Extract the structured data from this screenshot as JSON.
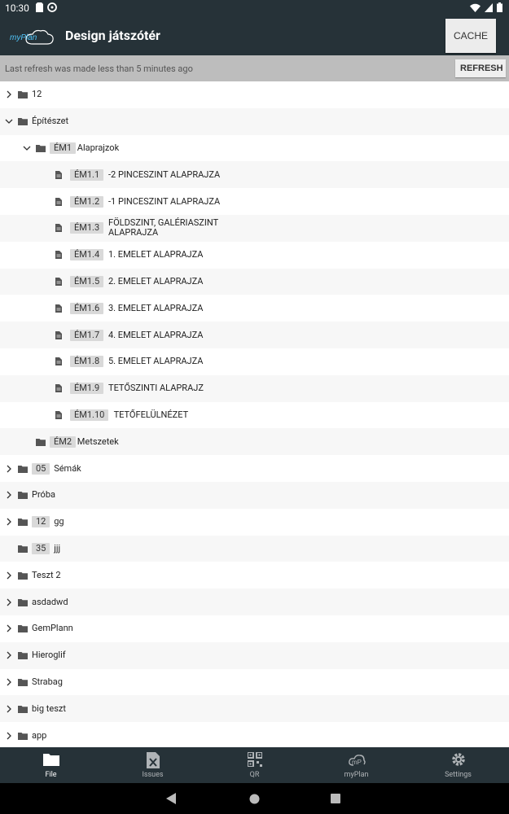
{
  "status": {
    "time": "10:30"
  },
  "header": {
    "logo_text": "myPlan",
    "title": "Design játszótér",
    "cache_label": "CACHE"
  },
  "refresh": {
    "message": "Last refresh was made less than 5 minutes ago",
    "button_label": "REFRESH"
  },
  "tree": [
    {
      "label": "12",
      "badge": "",
      "level": 0,
      "kind": "folder",
      "chevron": "right"
    },
    {
      "label": "Építészet",
      "badge": "",
      "level": 0,
      "kind": "folder",
      "chevron": "down"
    },
    {
      "label": "Alaprajzok",
      "badge": "ÉM1",
      "level": 1,
      "kind": "folder",
      "chevron": "down"
    },
    {
      "label": "-2 PINCESZINT ALAPRAJZA",
      "badge": "ÉM1.1",
      "level": 2,
      "kind": "doc",
      "chevron": ""
    },
    {
      "label": "-1 PINCESZINT ALAPRAJZA",
      "badge": "ÉM1.2",
      "level": 2,
      "kind": "doc",
      "chevron": ""
    },
    {
      "label": "FÖLDSZINT, GALÉRIASZINT\nALAPRAJZA",
      "badge": "ÉM1.3",
      "level": 2,
      "kind": "doc",
      "chevron": ""
    },
    {
      "label": "1. EMELET ALAPRAJZA",
      "badge": "ÉM1.4",
      "level": 2,
      "kind": "doc",
      "chevron": ""
    },
    {
      "label": "2. EMELET ALAPRAJZA",
      "badge": "ÉM1.5",
      "level": 2,
      "kind": "doc",
      "chevron": ""
    },
    {
      "label": "3. EMELET ALAPRAJZA",
      "badge": "ÉM1.6",
      "level": 2,
      "kind": "doc",
      "chevron": ""
    },
    {
      "label": "4. EMELET ALAPRAJZA",
      "badge": "ÉM1.7",
      "level": 2,
      "kind": "doc",
      "chevron": ""
    },
    {
      "label": "5. EMELET ALAPRAJZA",
      "badge": "ÉM1.8",
      "level": 2,
      "kind": "doc",
      "chevron": ""
    },
    {
      "label": "TETŐSZINTI ALAPRAJZ",
      "badge": "ÉM1.9",
      "level": 2,
      "kind": "doc",
      "chevron": ""
    },
    {
      "label": "TETŐFELÜLNÉZET",
      "badge": "ÉM1.10",
      "level": 2,
      "kind": "doc",
      "chevron": ""
    },
    {
      "label": "Metszetek",
      "badge": "ÉM2",
      "level": 1,
      "kind": "folder",
      "chevron": ""
    },
    {
      "label": "Sémák",
      "badge": "05",
      "level": 0,
      "kind": "folder",
      "chevron": "right"
    },
    {
      "label": "Próba",
      "badge": "",
      "level": 0,
      "kind": "folder",
      "chevron": "right"
    },
    {
      "label": "gg",
      "badge": "12",
      "level": 0,
      "kind": "folder",
      "chevron": "right"
    },
    {
      "label": "jjj",
      "badge": "35",
      "level": 0,
      "kind": "folder",
      "chevron": ""
    },
    {
      "label": "Teszt 2",
      "badge": "",
      "level": 0,
      "kind": "folder",
      "chevron": "right"
    },
    {
      "label": "asdadwd",
      "badge": "",
      "level": 0,
      "kind": "folder",
      "chevron": "right"
    },
    {
      "label": "GemPlann",
      "badge": "",
      "level": 0,
      "kind": "folder",
      "chevron": "right"
    },
    {
      "label": "Hieroglif",
      "badge": "",
      "level": 0,
      "kind": "folder",
      "chevron": "right"
    },
    {
      "label": "Strabag",
      "badge": "",
      "level": 0,
      "kind": "folder",
      "chevron": "right"
    },
    {
      "label": "big teszt",
      "badge": "",
      "level": 0,
      "kind": "folder",
      "chevron": "right"
    },
    {
      "label": "app",
      "badge": "",
      "level": 0,
      "kind": "folder",
      "chevron": "right"
    }
  ],
  "bottom_nav": [
    {
      "label": "File",
      "icon": "folder-icon",
      "active": true
    },
    {
      "label": "Issues",
      "icon": "excel-icon",
      "active": false
    },
    {
      "label": "QR",
      "icon": "qr-icon",
      "active": false
    },
    {
      "label": "myPlan",
      "icon": "myplan-icon",
      "active": false
    },
    {
      "label": "Settings",
      "icon": "gear-icon",
      "active": false
    }
  ]
}
